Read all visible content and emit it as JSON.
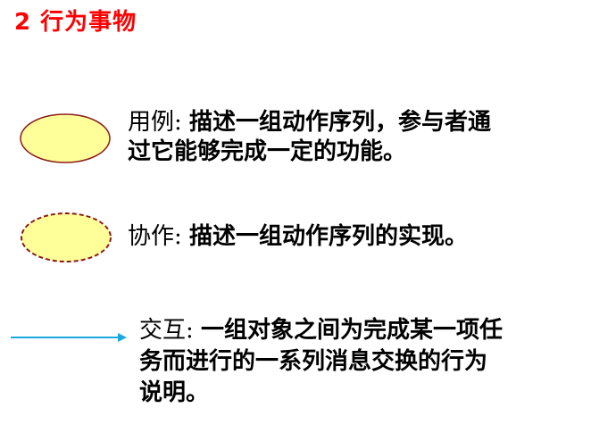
{
  "title": "2  行为事物",
  "items": [
    {
      "term": "用例:",
      "lines": [
        "描述一组动作序列，参与者通",
        "过它能够完成一定的功能。"
      ],
      "icon": "use-case-ellipse-icon"
    },
    {
      "term": "协作:",
      "lines": [
        "描述一组动作序列的实现。"
      ],
      "icon": "collaboration-dashed-ellipse-icon"
    },
    {
      "term": "交互:",
      "lines": [
        "一组对象之间为完成某一项任",
        "务而进行的一系列消息交换的行为",
        "说明。"
      ],
      "icon": "message-arrow-icon"
    }
  ],
  "colors": {
    "title": "#ff0000",
    "ellipse_fill": "#ffff99",
    "ellipse_stroke": "#8b1a1a",
    "arrow": "#1aa8e0"
  }
}
